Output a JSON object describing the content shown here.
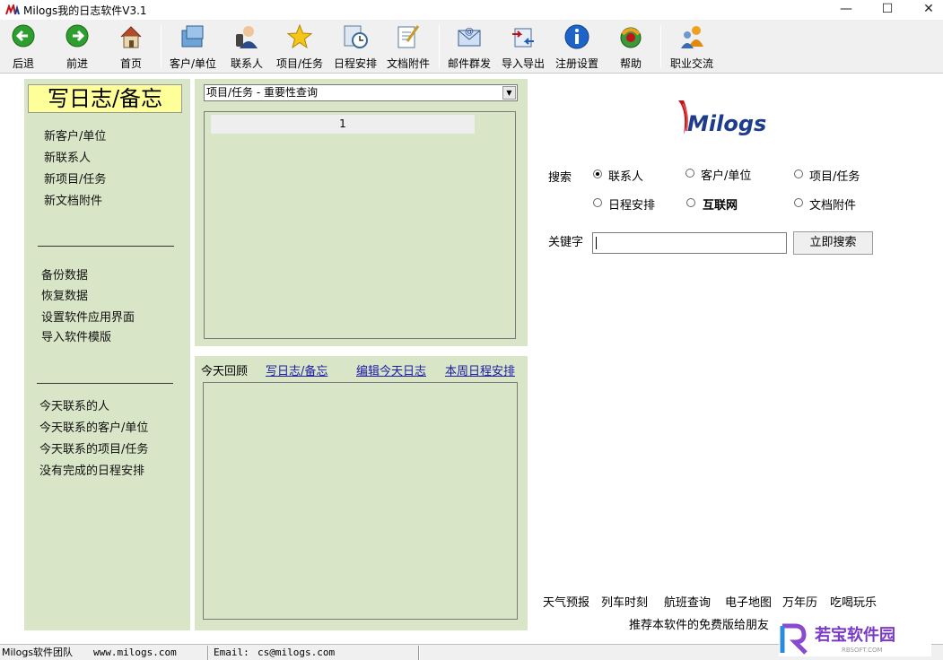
{
  "window": {
    "title": "Milogs我的日志软件V3.1",
    "minimize": "—",
    "maximize": "☐",
    "close": "✕"
  },
  "toolbar": {
    "back": "后退",
    "forward": "前进",
    "home": "首页",
    "clients": "客户/单位",
    "contacts": "联系人",
    "projects": "项目/任务",
    "schedule": "日程安排",
    "docs": "文档附件",
    "mail": "邮件群发",
    "import_export": "导入导出",
    "register": "注册设置",
    "help": "帮助",
    "career": "职业交流"
  },
  "left": {
    "write_button": "写日志/备忘",
    "group1": [
      "新客户/单位",
      "新联系人",
      "新项目/任务",
      "新文档附件"
    ],
    "group2": [
      "备份数据",
      "恢复数据",
      "设置软件应用界面",
      "导入软件模版"
    ],
    "group3": [
      "今天联系的人",
      "今天联系的客户/单位",
      "今天联系的项目/任务",
      "没有完成的日程安排"
    ]
  },
  "query": {
    "selected": "项目/任务 - 重要性查询",
    "column_header": "1"
  },
  "today": {
    "label": "今天回顾",
    "write": "写日志/备忘",
    "edit": "编辑今天日志",
    "week": "本周日程安排"
  },
  "search": {
    "logo": "Milogs",
    "label": "搜索",
    "options": [
      "联系人",
      "客户/单位",
      "项目/任务",
      "日程安排",
      "互联网",
      "文档附件"
    ],
    "keyword_label": "关键字",
    "keyword_value": "",
    "button": "立即搜索"
  },
  "links": {
    "items": [
      "天气预报",
      "列车时刻",
      "航班查询",
      "电子地图",
      "万年历",
      "吃喝玩乐"
    ],
    "recommend": "推荐本软件的免费版给朋友"
  },
  "status": {
    "team": "Milogs软件团队",
    "site": "www.milogs.com",
    "email_label": "Email:",
    "email": "cs@milogs.com"
  },
  "watermark": {
    "text": "若宝软件园",
    "sub": "RBSOFT.COM"
  }
}
